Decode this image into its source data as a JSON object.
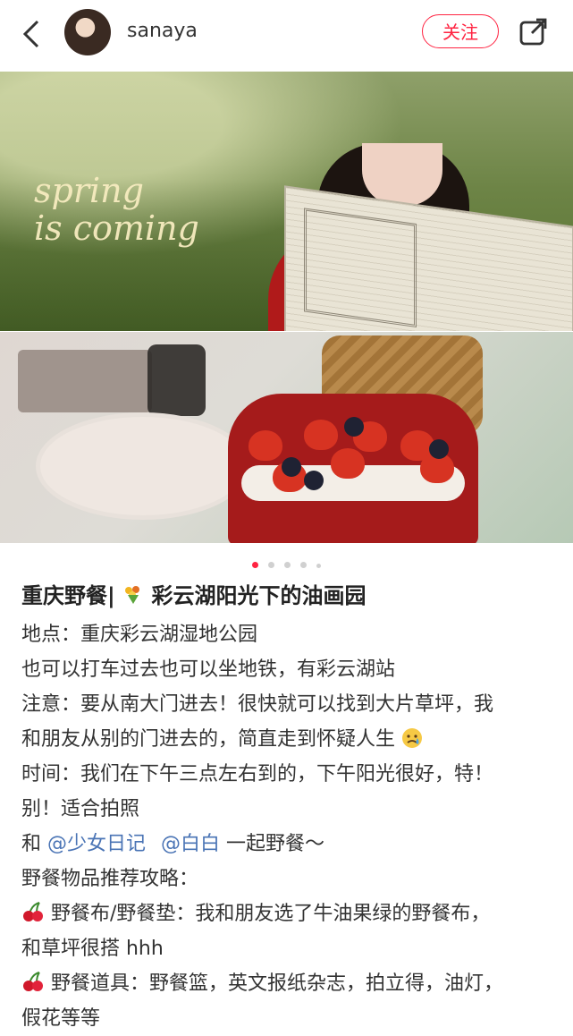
{
  "header": {
    "username": "sanaya",
    "follow_label": "关注"
  },
  "icons": {
    "back": "back-arrow-icon",
    "share": "share-icon",
    "title_emoji": "bouquet-icon",
    "cry": "crying-face-icon",
    "cherry": "cherry-icon"
  },
  "colors": {
    "accent": "#ff2442",
    "mention": "#4a74b5"
  },
  "image": {
    "overlay_text_line1": "spring",
    "overlay_text_line2": "is coming",
    "carousel_pages": 5,
    "carousel_active": 1
  },
  "post": {
    "title_prefix": "重庆野餐|",
    "title_suffix": "彩云湖阳光下的油画园",
    "line1": "地点：重庆彩云湖湿地公园",
    "line2": "也可以打车过去也可以坐地铁，有彩云湖站",
    "line3": "注意：要从南大门进去！很快就可以找到大片草坪，我",
    "line4": "和朋友从别的门进去的，简直走到怀疑人生",
    "line5": "时间：我们在下午三点左右到的，下午阳光很好，特！",
    "line6": "别！适合拍照",
    "line7_prefix": "和 ",
    "mention1": "@少女日记",
    "mention2": "@白白",
    "line7_suffix": " 一起野餐～",
    "line8": "野餐物品推荐攻略：",
    "line9": "野餐布/野餐垫：我和朋友选了牛油果绿的野餐布，",
    "line10": "和草坪很搭 hhh",
    "line11": "野餐道具：野餐篮，英文报纸杂志，拍立得，油灯，",
    "line12": "假花等等"
  }
}
